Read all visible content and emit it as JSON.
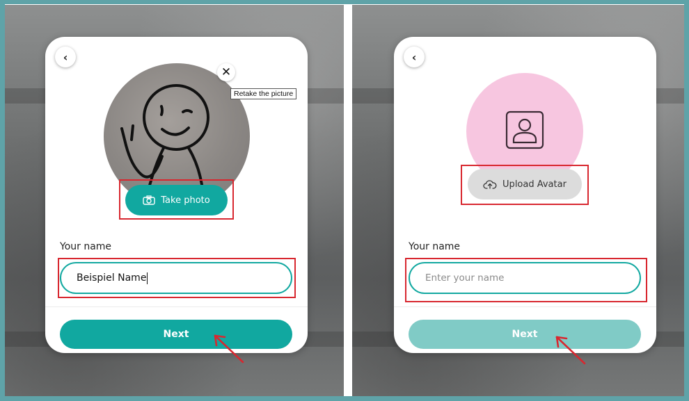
{
  "colors": {
    "frame": "#5fa3a8",
    "primary": "#11a8a0",
    "primary_disabled": "#80cbc6",
    "highlight": "#d8272f",
    "avatar_bg": "#f7c6e0",
    "upload_bg": "#dcdcdc"
  },
  "left_screen": {
    "back_icon": "chevron-left-icon",
    "back_glyph": "‹",
    "close_icon": "close-icon",
    "close_glyph": "✕",
    "tooltip": "Retake the picture",
    "take_photo_label": "Take photo",
    "camera_icon": "camera-icon",
    "name_label": "Your name",
    "name_value": "Beispiel Name",
    "next_label": "Next"
  },
  "right_screen": {
    "back_icon": "chevron-left-icon",
    "back_glyph": "‹",
    "avatar_icon": "user-portrait-icon",
    "upload_icon": "cloud-upload-icon",
    "upload_label": "Upload Avatar",
    "name_label": "Your name",
    "name_placeholder": "Enter your name",
    "next_label": "Next"
  }
}
